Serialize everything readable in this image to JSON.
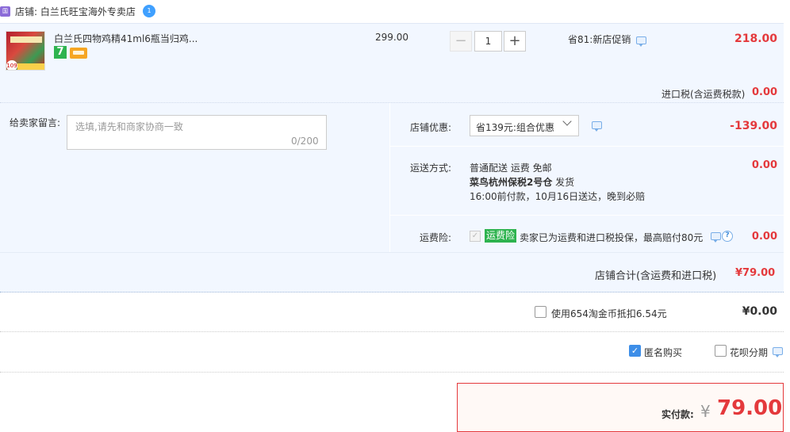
{
  "shop": {
    "badge": "国际",
    "name": "店铺: 白兰氏旺宝海外专卖店",
    "ww_icon": "1"
  },
  "item": {
    "title": "白兰氏四物鸡精41ml6瓶当归鸡...",
    "unit_price": "299.00",
    "quantity": "1",
    "qty_minus": "−",
    "qty_plus": "+",
    "promo": "省81:新店促销",
    "total": "218.00",
    "service_seven": "7",
    "thumb_badge": "109",
    "import_tax_label": "进口税(含运费税款)",
    "import_tax_value": "0.00"
  },
  "options": {
    "message_label": "给卖家留言:",
    "message_placeholder": "选填,请先和商家协商一致",
    "message_counter": "0/200",
    "shop_discount_label": "店铺优惠:",
    "shop_discount_value": "省139元:组合优惠",
    "shop_discount_amount": "-139.00",
    "shipping_label": "运送方式:",
    "shipping_line1": "普通配送 运费 免邮",
    "shipping_line2_bold": "菜鸟杭州保税2号仓",
    "shipping_line2_light": "  发货",
    "shipping_line3": "16:00前付款，10月16日送达，晚到必赔",
    "shipping_amount": "0.00",
    "insurance_label": "运费险:",
    "insurance_badge": "运费险",
    "insurance_desc": "卖家已为运费和进口税投保，最高赔付80元",
    "insurance_amount": "0.00",
    "insurance_help": "?"
  },
  "shop_total": {
    "label": "店铺合计(含运费和进口税)",
    "value": "¥79.00"
  },
  "coins": {
    "label": "使用654淘金币抵扣6.54元",
    "value": "¥0.00"
  },
  "extras": {
    "anonymous_label": "匿名购买",
    "anonymous_checked": "✓",
    "huabei_label": "花呗分期"
  },
  "payment": {
    "label": "实付款:",
    "yen": "¥",
    "amount": "79.00"
  },
  "colors": {
    "accent_red": "#e4393c",
    "panel_bg": "#f2f7ff",
    "green_badge": "#2eb34f",
    "checkbox_blue": "#3d8ee8"
  }
}
